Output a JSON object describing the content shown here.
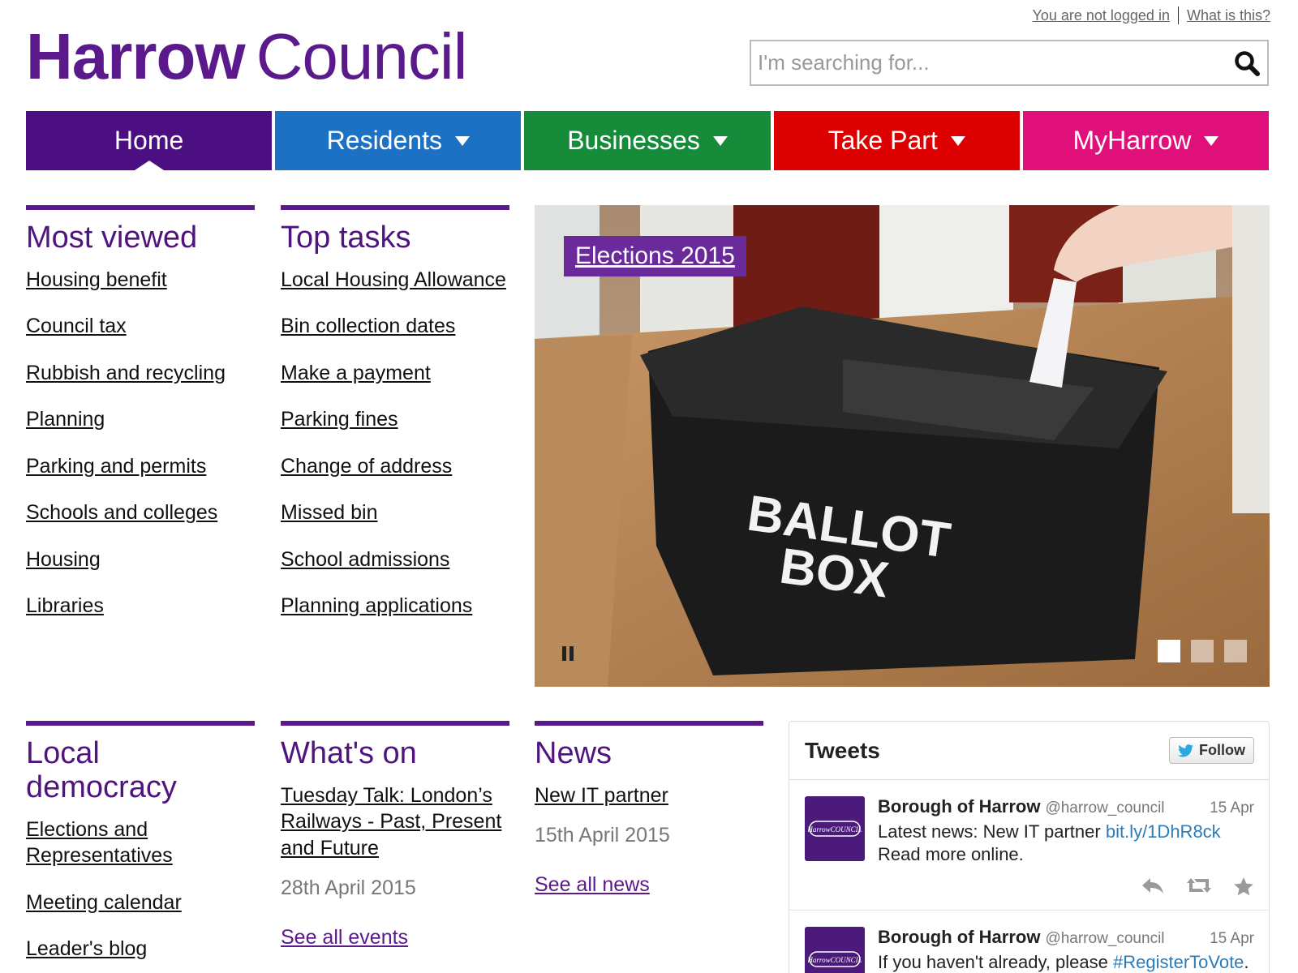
{
  "topbar": {
    "login_status": "You are not logged in",
    "what_is_this": "What is this?"
  },
  "logo": {
    "bold": "Harrow",
    "normal": "Council"
  },
  "search": {
    "placeholder": "I'm searching for..."
  },
  "nav": {
    "items": [
      {
        "label": "Home",
        "color": "#4b0f82"
      },
      {
        "label": "Residents",
        "color": "#1d71c4"
      },
      {
        "label": "Businesses",
        "color": "#168c3a"
      },
      {
        "label": "Take Part",
        "color": "#dd0000"
      },
      {
        "label": "MyHarrow",
        "color": "#e0107a"
      }
    ]
  },
  "most_viewed": {
    "title": "Most viewed",
    "links": [
      "Housing benefit",
      "Council tax",
      "Rubbish and recycling",
      "Planning",
      "Parking and permits",
      "Schools and colleges",
      "Housing",
      "Libraries"
    ]
  },
  "top_tasks": {
    "title": "Top tasks",
    "links": [
      "Local Housing Allowance",
      "Bin collection dates",
      "Make a payment",
      "Parking fines",
      "Change of address",
      "Missed bin",
      "School admissions",
      "Planning applications"
    ]
  },
  "hero": {
    "tag": "Elections 2015",
    "box_line1": "BALLOT",
    "box_line2": "BOX"
  },
  "local_democracy": {
    "title": "Local democracy",
    "links": [
      "Elections and Representatives",
      "Meeting calendar",
      "Leader's blog"
    ]
  },
  "whats_on": {
    "title": "What's on",
    "event": "Tuesday Talk: London’s Railways - Past, Present and Future",
    "date": "28th April 2015",
    "more": "See all events"
  },
  "news": {
    "title": "News",
    "item": "New IT partner",
    "date": "15th April 2015",
    "more": "See all news"
  },
  "tweets": {
    "title": "Tweets",
    "follow": "Follow",
    "avatar_text": "HarrowCOUNCIL",
    "items": [
      {
        "name": "Borough of Harrow",
        "handle": "@harrow_council",
        "time": "15 Apr",
        "text_before": "Latest news: New IT partner ",
        "link": "bit.ly/1DhR8ck",
        "text_after": " Read more online."
      },
      {
        "name": "Borough of Harrow",
        "handle": "@harrow_council",
        "time": "15 Apr",
        "text_before": "If you haven't already, please ",
        "link": "#RegisterToVote",
        "text_after": ". It only takes a few minutes. Visit our website for"
      }
    ]
  }
}
